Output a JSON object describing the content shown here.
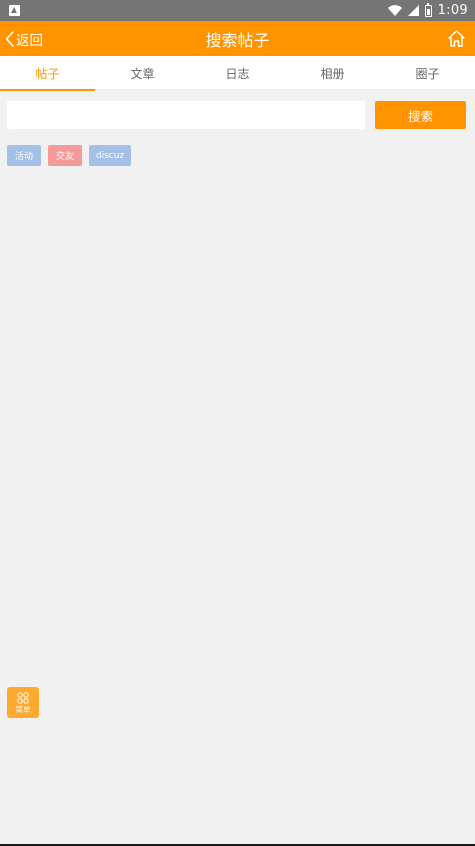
{
  "status_bar": {
    "time": "1:09",
    "icons": [
      "notification-icon",
      "wifi-icon",
      "signal-icon",
      "battery-icon"
    ]
  },
  "nav": {
    "back_label": "返回",
    "title": "搜索帖子",
    "home_icon": "home-icon"
  },
  "tabs": [
    {
      "label": "帖子",
      "active": true
    },
    {
      "label": "文章",
      "active": false
    },
    {
      "label": "日志",
      "active": false
    },
    {
      "label": "相册",
      "active": false
    },
    {
      "label": "圈子",
      "active": false
    }
  ],
  "search": {
    "value": "",
    "placeholder": "",
    "button_label": "搜索"
  },
  "tags": [
    {
      "label": "活动",
      "color": "#a3c1e6"
    },
    {
      "label": "交友",
      "color": "#f59a9a"
    },
    {
      "label": "discuz",
      "color": "#a3c1e6"
    }
  ],
  "floating_menu": {
    "label": "菜单",
    "icon": "grid-icon",
    "color": "#ffa92e"
  },
  "colors": {
    "accent": "#ff9300",
    "status_bar": "#757575",
    "background": "#f1f1f1"
  }
}
